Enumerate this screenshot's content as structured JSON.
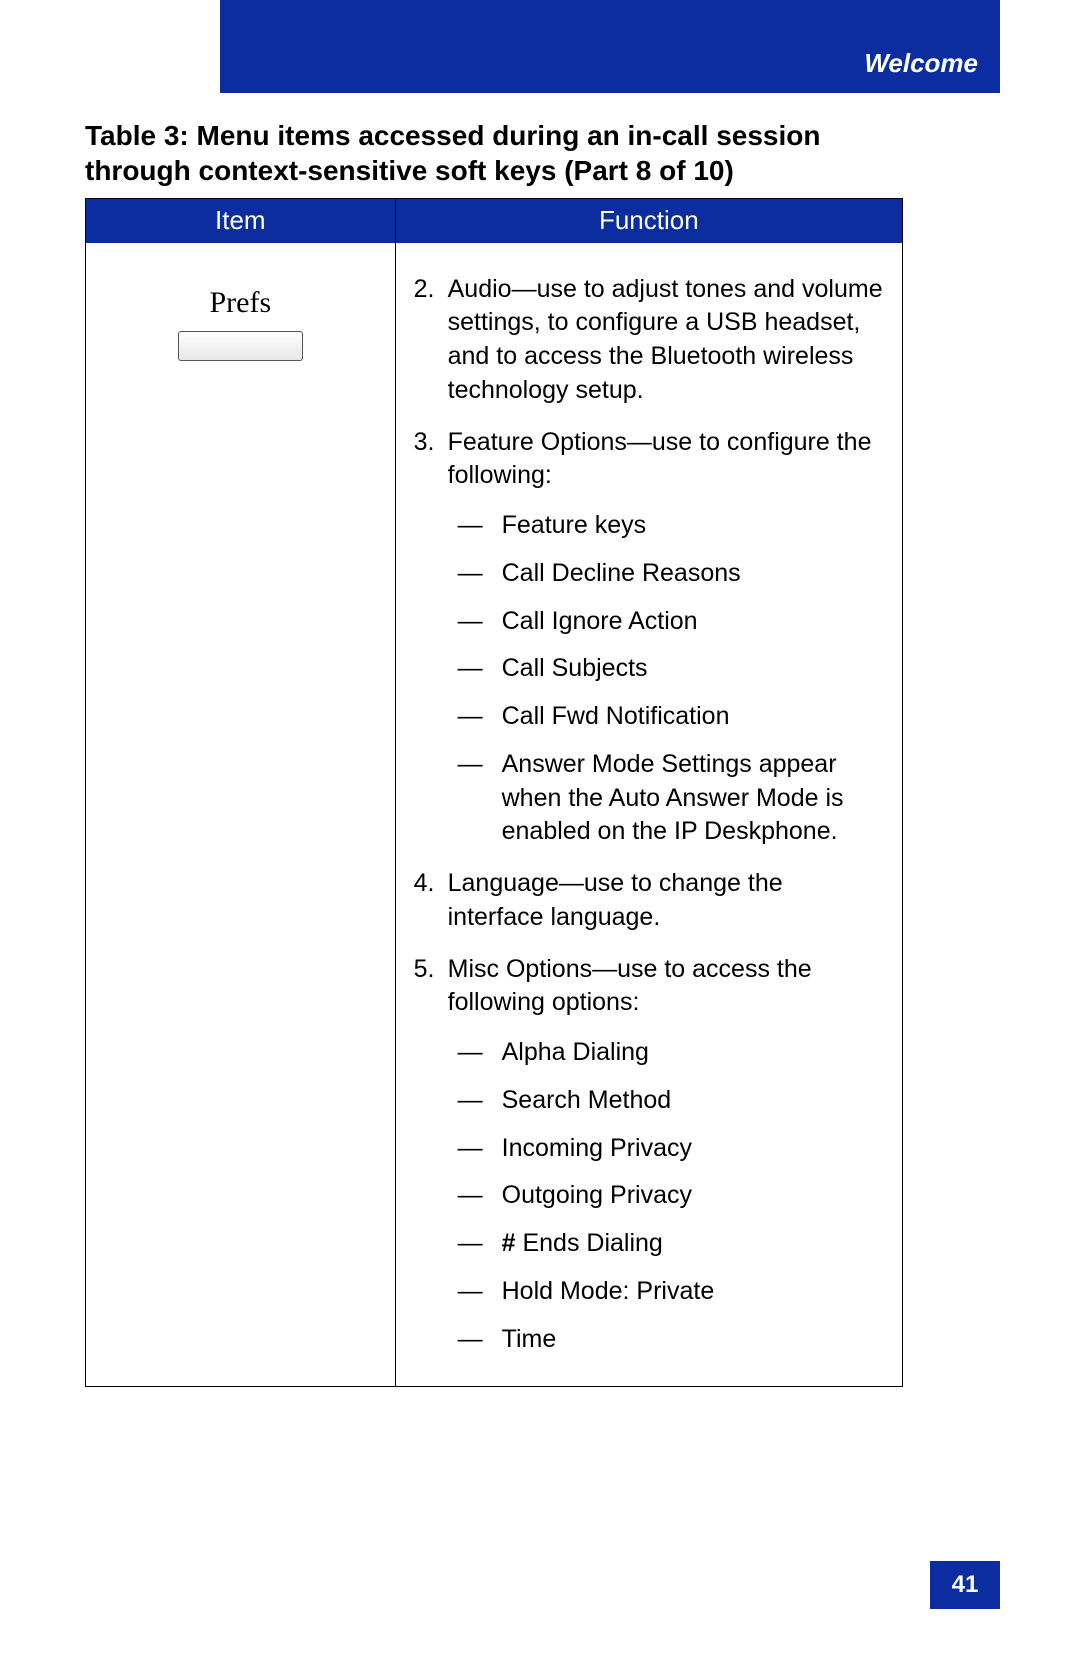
{
  "header": {
    "section": "Welcome"
  },
  "caption": "Table 3: Menu items accessed during an in-call session through context-sensitive soft keys (Part 8 of 10)",
  "columns": {
    "item": "Item",
    "function": "Function"
  },
  "row": {
    "item_label": "Prefs",
    "functions": [
      {
        "num": "2.",
        "text": "Audio—use to adjust tones and volume settings, to configure a USB headset, and to access the Bluetooth wireless technology setup."
      },
      {
        "num": "3.",
        "text": "Feature Options—use to configure the following:",
        "sub": [
          "Feature keys",
          "Call Decline Reasons",
          "Call Ignore Action",
          "Call Subjects",
          "Call Fwd Notification",
          "Answer Mode Settings appear when the Auto Answer Mode is enabled on the IP Deskphone."
        ]
      },
      {
        "num": "4.",
        "text": "Language—use to change the interface language."
      },
      {
        "num": "5.",
        "text": "Misc Options—use to access the following options:",
        "sub": [
          "Alpha Dialing",
          "Search Method",
          "Incoming Privacy",
          "Outgoing Privacy",
          "# Ends Dialing",
          "Hold Mode: Private",
          "Time"
        ]
      }
    ]
  },
  "page_number": "41",
  "dash": "—",
  "hash_prefix": "#"
}
